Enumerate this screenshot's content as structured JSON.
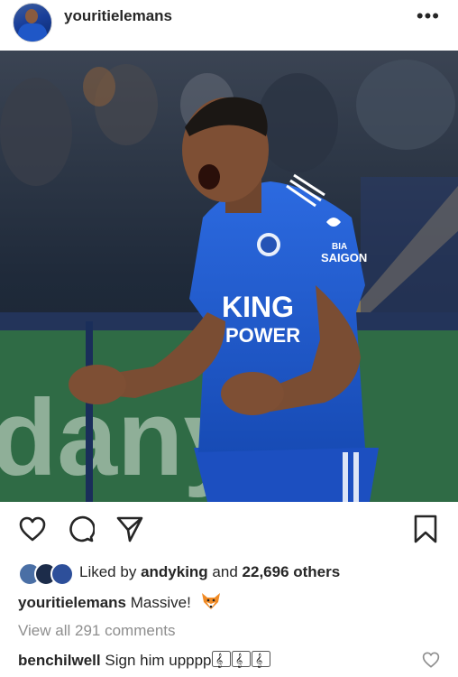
{
  "header": {
    "username": "youritielemans",
    "more_label": "•••"
  },
  "photo": {
    "jersey_sponsor_line1": "KING",
    "jersey_sponsor_line2": "POWER",
    "sleeve_sponsor_line1": "BIA",
    "sleeve_sponsor_line2": "SAIGON",
    "colors": {
      "kit": "#1f55c6",
      "background": "#1c2736",
      "board": "#2f6b45"
    }
  },
  "actions": {
    "icons": [
      "heart-icon",
      "comment-icon",
      "share-icon",
      "bookmark-icon"
    ]
  },
  "likes": {
    "prefix": "Liked by",
    "user": "andyking",
    "connector": "and",
    "others": "22,696 others"
  },
  "caption": {
    "user": "youritielemans",
    "text": "Massive!",
    "emoji": "fox-icon"
  },
  "comments": {
    "view_all": "View all 291 comments",
    "items": [
      {
        "user": "benchilwell",
        "text": "Sign him upppp",
        "emoji": "music-notes-icon"
      }
    ]
  }
}
